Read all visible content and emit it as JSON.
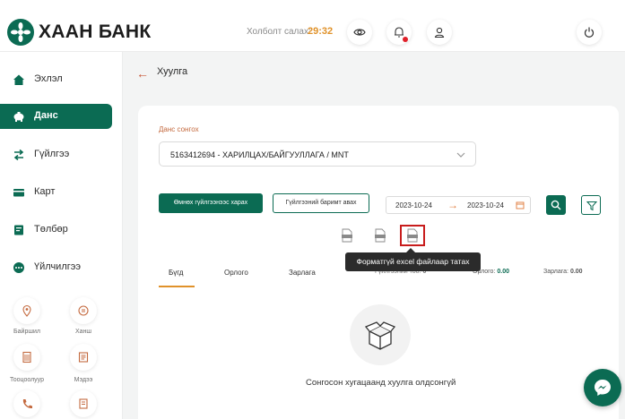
{
  "header": {
    "brand": "ХААН БАНК",
    "session_label": "Холболт салах:",
    "session_timer": "29:32"
  },
  "sidebar": {
    "items": [
      {
        "label": "Эхлэл",
        "icon": "home-icon"
      },
      {
        "label": "Данс",
        "icon": "piggy-bank-icon",
        "active": true
      },
      {
        "label": "Гүйлгээ",
        "icon": "transfer-icon"
      },
      {
        "label": "Карт",
        "icon": "card-icon"
      },
      {
        "label": "Төлбөр",
        "icon": "bill-icon"
      },
      {
        "label": "Үйлчилгээ",
        "icon": "more-icon"
      }
    ],
    "quick": [
      {
        "label": "Байршил",
        "icon": "location-icon"
      },
      {
        "label": "Ханш",
        "icon": "exchange-icon"
      },
      {
        "label": "Тооцоолуур",
        "icon": "calculator-icon"
      },
      {
        "label": "Мэдээ",
        "icon": "news-icon"
      }
    ]
  },
  "page": {
    "title": "Хуулга"
  },
  "form": {
    "account_label": "Данс сонгох",
    "account_value": "5163412694 - ХАРИЛЦАХ/БАЙГУУЛЛАГА / MNT",
    "prev_button": "Өмнөх гүйлгээнээс харах",
    "receipt_button": "Гүйлгээний баримт авах",
    "date_from": "2023-10-24",
    "date_to": "2023-10-24"
  },
  "tooltip": "Форматгүй excel файлаар татах",
  "tabs": [
    {
      "label": "Бүгд",
      "active": true
    },
    {
      "label": "Орлого"
    },
    {
      "label": "Зарлага"
    }
  ],
  "summary": {
    "count_label": "Гүйлгээний тоо:",
    "count_value": "0",
    "income_label": "Орлого:",
    "income_value": "0.00",
    "expense_label": "Зарлага:",
    "expense_value": "0.00"
  },
  "empty_state": "Сонгосон хугацаанд хуулга олдсонгүй",
  "colors": {
    "brand_green": "#0b6b53",
    "accent_orange": "#e0922a",
    "highlight_red": "#c81c1c"
  }
}
